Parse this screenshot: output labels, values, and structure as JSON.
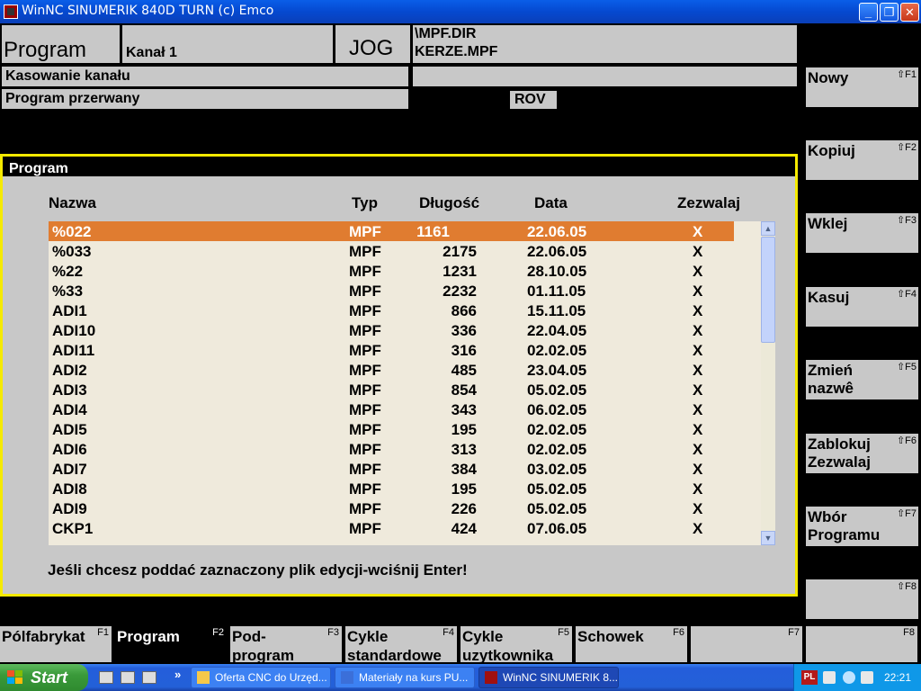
{
  "window": {
    "title": "WinNC SINUMERIK 840D TURN (c) Emco"
  },
  "header": {
    "area": "Program",
    "channel": "Kanał 1",
    "mode": "JOG",
    "path_dir": "\\MPF.DIR",
    "path_file": "KERZE.MPF",
    "channel_status": "Kasowanie kanału",
    "program_status": "Program przerwany",
    "rov": "ROV"
  },
  "program_panel": {
    "title": "Program",
    "columns": {
      "name": "Nazwa",
      "type": "Typ",
      "length": "Długość",
      "date": "Data",
      "allow": "Zezwalaj"
    },
    "rows": [
      {
        "name": "%022",
        "type": "MPF",
        "length": "1161",
        "date": "22.06.05",
        "allow": "X",
        "selected": true
      },
      {
        "name": "%033",
        "type": "MPF",
        "length": "2175",
        "date": "22.06.05",
        "allow": "X"
      },
      {
        "name": "%22",
        "type": "MPF",
        "length": "1231",
        "date": "28.10.05",
        "allow": "X"
      },
      {
        "name": "%33",
        "type": "MPF",
        "length": "2232",
        "date": "01.11.05",
        "allow": "X"
      },
      {
        "name": "ADI1",
        "type": "MPF",
        "length": "866",
        "date": "15.11.05",
        "allow": "X"
      },
      {
        "name": "ADI10",
        "type": "MPF",
        "length": "336",
        "date": "22.04.05",
        "allow": "X"
      },
      {
        "name": "ADI11",
        "type": "MPF",
        "length": "316",
        "date": "02.02.05",
        "allow": "X"
      },
      {
        "name": "ADI2",
        "type": "MPF",
        "length": "485",
        "date": "23.04.05",
        "allow": "X"
      },
      {
        "name": "ADI3",
        "type": "MPF",
        "length": "854",
        "date": "05.02.05",
        "allow": "X"
      },
      {
        "name": "ADI4",
        "type": "MPF",
        "length": "343",
        "date": "06.02.05",
        "allow": "X"
      },
      {
        "name": "ADI5",
        "type": "MPF",
        "length": "195",
        "date": "02.02.05",
        "allow": "X"
      },
      {
        "name": "ADI6",
        "type": "MPF",
        "length": "313",
        "date": "02.02.05",
        "allow": "X"
      },
      {
        "name": "ADI7",
        "type": "MPF",
        "length": "384",
        "date": "03.02.05",
        "allow": "X"
      },
      {
        "name": "ADI8",
        "type": "MPF",
        "length": "195",
        "date": "05.02.05",
        "allow": "X"
      },
      {
        "name": "ADI9",
        "type": "MPF",
        "length": "226",
        "date": "05.02.05",
        "allow": "X"
      },
      {
        "name": "CKP1",
        "type": "MPF",
        "length": "424",
        "date": "07.06.05",
        "allow": "X"
      }
    ],
    "hint": "Jeśli chcesz poddać zaznaczony plik edycji-wciśnij Enter!"
  },
  "right_softkeys": [
    {
      "label": "Nowy",
      "key": "⇧F1"
    },
    {
      "label": "Kopiuj",
      "key": "⇧F2"
    },
    {
      "label": "Wklej",
      "key": "⇧F3"
    },
    {
      "label": "Kasuj",
      "key": "⇧F4"
    },
    {
      "label": "Zmień\nnazwê",
      "key": "⇧F5"
    },
    {
      "label": "Zablokuj\nZezwalaj",
      "key": "⇧F6"
    },
    {
      "label": "Wbór\nProgramu",
      "key": "⇧F7"
    },
    {
      "label": "",
      "key": "⇧F8"
    }
  ],
  "bottom_softkeys": [
    {
      "label": "Pólfabrykat",
      "key": "F1"
    },
    {
      "label": "Program",
      "key": "F2",
      "active": true
    },
    {
      "label": "Pod-\nprogram",
      "key": "F3"
    },
    {
      "label": "Cykle\nstandardowe",
      "key": "F4"
    },
    {
      "label": "Cykle\nuzytkownika",
      "key": "F5"
    },
    {
      "label": "Schowek",
      "key": "F6"
    },
    {
      "label": "",
      "key": "F7"
    },
    {
      "label": "",
      "key": "F8"
    }
  ],
  "taskbar": {
    "start": "Start",
    "tasks": [
      {
        "label": "Oferta CNC do Urzęd..."
      },
      {
        "label": "Materiały na kurs PU..."
      },
      {
        "label": "WinNC SINUMERIK 8...",
        "active": true
      }
    ],
    "language": "PL",
    "clock": "22:21"
  }
}
